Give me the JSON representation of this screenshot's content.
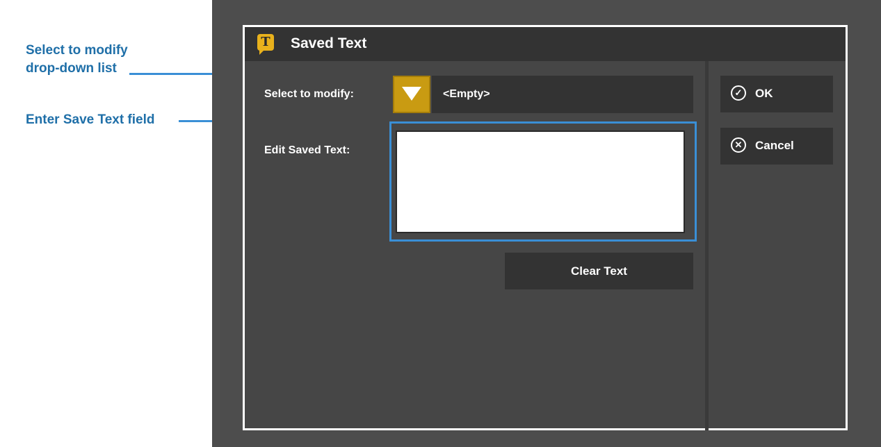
{
  "annotations": {
    "dropdown_callout_line1": "Select to modify",
    "dropdown_callout_line2": "drop-down list",
    "textfield_callout": "Enter Save Text field"
  },
  "dialog": {
    "title": "Saved Text",
    "title_icon_glyph": "T",
    "title_icon_name": "saved-text-icon",
    "select_label": "Select to modify:",
    "select_value": "<Empty>",
    "edit_label": "Edit Saved Text:",
    "edit_value": "",
    "clear_button": "Clear Text",
    "ok_button": "OK",
    "cancel_button": "Cancel"
  },
  "colors": {
    "accent_gold": "#c99b12",
    "callout_blue": "#3a8fd6",
    "callout_text": "#1f6fa8"
  }
}
